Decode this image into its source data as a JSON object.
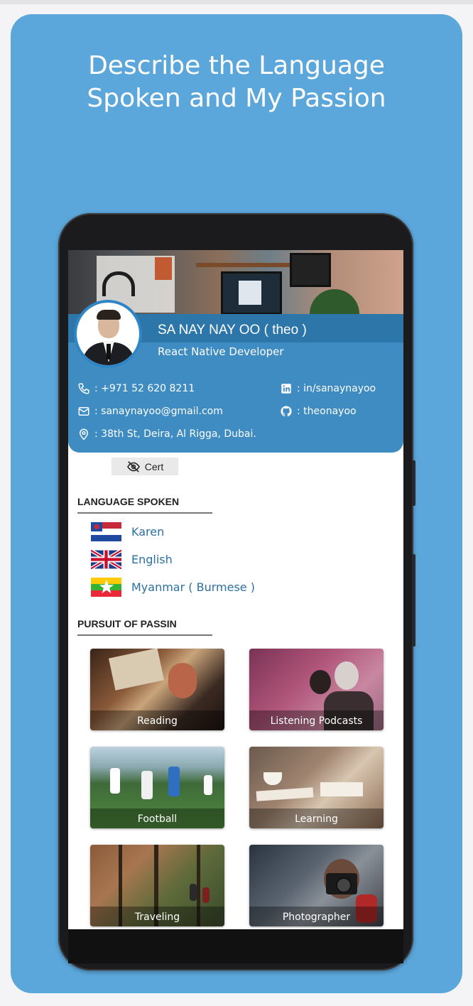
{
  "headline": {
    "line1": "Describe the Language",
    "line2": "Spoken and My Passion"
  },
  "profile": {
    "name": "SA NAY NAY OO ( theo )",
    "role": "React Native Developer",
    "phone": ": +971 52 620 8211",
    "email": ": sanaynayoo@gmail.com",
    "address": ": 38th St, Deira, Al Rigga, Dubai.",
    "linkedin": ": in/sanaynayoo",
    "github": ": theonayoo"
  },
  "cert_button": {
    "label": "Cert"
  },
  "languages": {
    "title": "LANGUAGE SPOKEN",
    "items": [
      {
        "label": "Karen",
        "flag": "karen-flag"
      },
      {
        "label": "English",
        "flag": "uk-flag"
      },
      {
        "label": "Myanmar ( Burmese )",
        "flag": "myanmar-flag"
      }
    ]
  },
  "passion": {
    "title": "PURSUIT OF PASSIN",
    "items": [
      {
        "label": "Reading"
      },
      {
        "label": "Listening Podcasts"
      },
      {
        "label": "Football"
      },
      {
        "label": "Learning"
      },
      {
        "label": "Traveling"
      },
      {
        "label": "Photographer"
      }
    ]
  },
  "colors": {
    "card_background": "#5ba6da",
    "profile_background": "#3e8cc2",
    "link_text": "#2c6fa1"
  }
}
